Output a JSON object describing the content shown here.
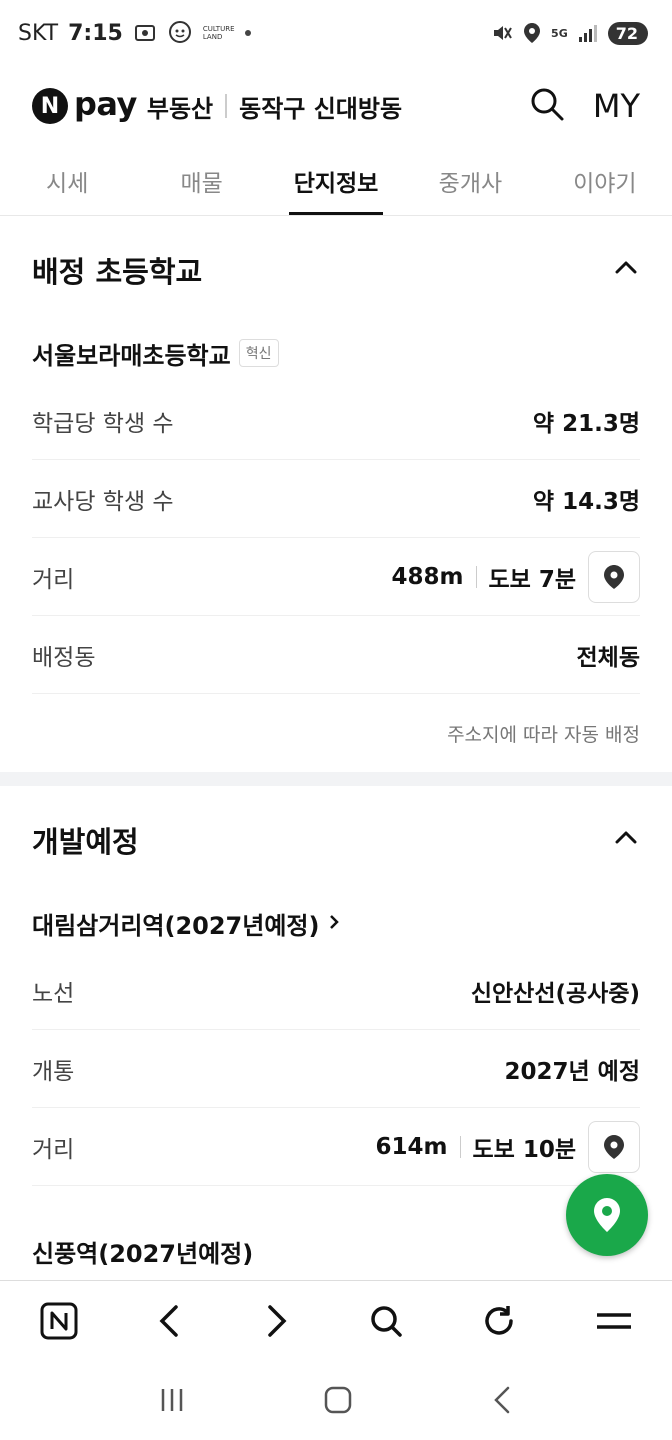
{
  "status_bar": {
    "carrier": "SKT",
    "time": "7:15",
    "culture_land": "CULTURE LAND",
    "network": "5G",
    "battery": "72"
  },
  "header": {
    "logo_n": "N",
    "logo_pay": "pay",
    "logo_service": "부동산",
    "region": "동작구 신대방동",
    "my_label": "MY"
  },
  "tabs": [
    {
      "label": "시세"
    },
    {
      "label": "매물"
    },
    {
      "label": "단지정보"
    },
    {
      "label": "중개사"
    },
    {
      "label": "이야기"
    }
  ],
  "school": {
    "section_title": "배정 초등학교",
    "name": "서울보라매초등학교",
    "badge": "혁신",
    "rows": [
      {
        "label": "학급당 학생 수",
        "value": "약 21.3명"
      },
      {
        "label": "교사당 학생 수",
        "value": "약 14.3명"
      },
      {
        "label": "거리",
        "distance": "488m",
        "walk": "도보 7분"
      },
      {
        "label": "배정동",
        "value": "전체동"
      }
    ],
    "note": "주소지에 따라 자동 배정"
  },
  "development": {
    "section_title": "개발예정",
    "item_title": "대림삼거리역(2027년예정)",
    "rows": [
      {
        "label": "노선",
        "value": "신안산선(공사중)"
      },
      {
        "label": "개통",
        "value": "2027년 예정"
      },
      {
        "label": "거리",
        "distance": "614m",
        "walk": "도보 10분"
      }
    ],
    "next_item_title": "신풍역(2027년예정)"
  },
  "colors": {
    "fab": "#1aa84a",
    "text": "#111111",
    "muted": "#888888"
  }
}
